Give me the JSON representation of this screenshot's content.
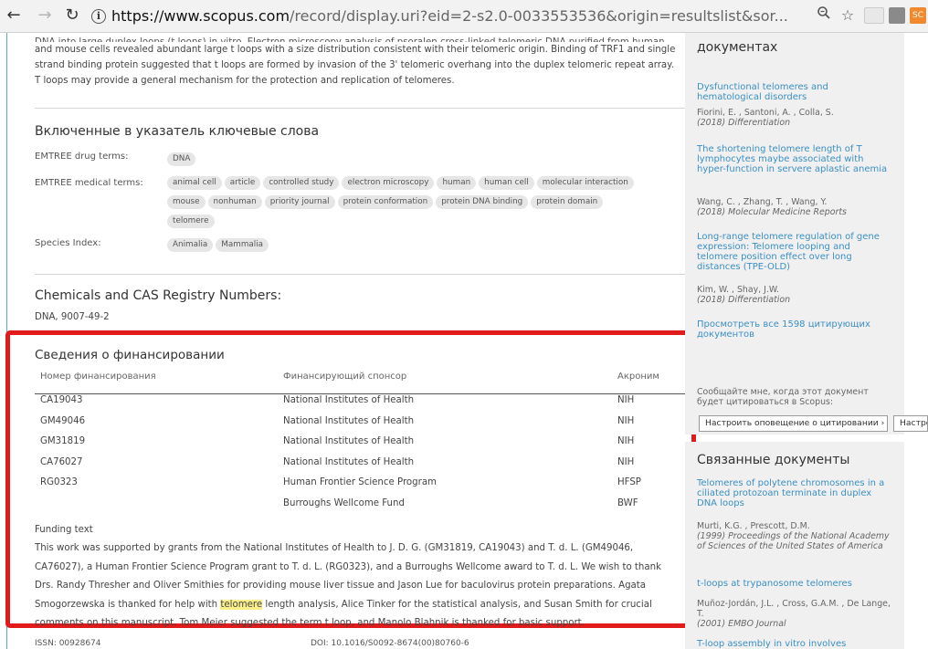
{
  "browser": {
    "url_host": "https://www.scopus.com",
    "url_rest": "/record/display.uri?eid=2-s2.0-0033553536&origin=resultslist&sor...",
    "ext1_label": "",
    "ext2_label": "",
    "ext3_label": "SC"
  },
  "abstract": {
    "cut_line": "DNA into large duplex loops (t loops) in vitro. Electron microscopy analysis of psoralen cross-linked telomeric DNA purified from human",
    "lines": [
      "and mouse cells revealed abundant large t loops with a size distribution consistent with their telomeric origin. Binding of TRF1 and single",
      "strand binding protein suggested that t loops are formed by invasion of the 3' telomeric overhang into the duplex telomeric repeat array.",
      "T loops may provide a general mechanism for the protection and replication of telomeres."
    ]
  },
  "keywords": {
    "title": "Включенные в указатель ключевые слова",
    "drug_label": "EMTREE drug terms:",
    "drug_terms": [
      "DNA"
    ],
    "medical_label": "EMTREE medical terms:",
    "medical_terms": [
      "animal cell",
      "article",
      "controlled study",
      "electron microscopy",
      "human",
      "human cell",
      "molecular interaction",
      "mouse",
      "nonhuman",
      "priority journal",
      "protein conformation",
      "protein DNA binding",
      "protein domain",
      "telomere"
    ],
    "species_label": "Species Index:",
    "species_terms": [
      "Animalia",
      "Mammalia"
    ]
  },
  "chemicals": {
    "title": "Chemicals and CAS Registry Numbers:",
    "value": "DNA, 9007-49-2"
  },
  "funding": {
    "title": "Сведения о финансировании",
    "col_number": "Номер финансирования",
    "col_sponsor": "Финансирующий спонсор",
    "col_acronym": "Акроним",
    "rows": [
      {
        "number": "CA19043",
        "sponsor": "National Institutes of Health",
        "acronym": "NIH"
      },
      {
        "number": "GM49046",
        "sponsor": "National Institutes of Health",
        "acronym": "NIH"
      },
      {
        "number": "GM31819",
        "sponsor": "National Institutes of Health",
        "acronym": "NIH"
      },
      {
        "number": "CA76027",
        "sponsor": "National Institutes of Health",
        "acronym": "NIH"
      },
      {
        "number": "RG0323",
        "sponsor": "Human Frontier Science Program",
        "acronym": "HFSP"
      },
      {
        "number": "",
        "sponsor": "Burroughs Wellcome Fund",
        "acronym": "BWF"
      }
    ],
    "text_label": "Funding text",
    "text_line1": "This work was supported by grants from the National Institutes of Health to J. D. G. (GM31819, CA19043) and T. d. L. (GM49046,",
    "text_line2": "CA76027), a Human Frontier Science Program grant to T. d. L. (RG0323), and a Burroughs Wellcome award to T. d. L. We wish to thank",
    "text_line3": "Drs. Randy Thresher and Oliver Smithies for providing mouse liver tissue and Jason Lue for baculovirus protein preparations. Agata",
    "text_line4_a": "Smogorzewska is thanked for help with ",
    "text_line4_hl": "telomere",
    "text_line4_b": " length analysis, Alice Tinker for the statistical analysis, and Susan Smith for crucial",
    "text_line5": "comments on this manuscript. Tom Meier suggested the term t loop, and Manolo Blahnik is thanked for basic support."
  },
  "bottom": {
    "issn": "ISSN: 00928674",
    "doi": "DOI: 10.1016/S0092-8674(00)80760-6"
  },
  "sidebar": {
    "cited_title": "документах",
    "cited": [
      {
        "title": "Dysfunctional telomeres and hematological disorders",
        "authors": "Fiorini, E. , Santoni, A. , Colla, S.",
        "journal": "(2018) Differentiation"
      },
      {
        "title": "The shortening telomere length of T lymphocytes maybe associated with hyper-function in servere aplastic anemia",
        "authors": "Wang, C. , Zhang, T. , Wang, Y.",
        "journal": "(2018) Molecular Medicine Reports"
      },
      {
        "title": "Long-range telomere regulation of gene expression: Telomere looping and telomere position effect over long distances (TPE-OLD)",
        "authors": "Kim, W. , Shay, J.W.",
        "journal": "(2018) Differentiation"
      }
    ],
    "view_all": "Просмотреть все 1598 цитирующих документов",
    "alert_note": "Сообщайте мне, когда этот документ будет цитироваться в Scopus:",
    "alert_button": "Настроить оповещение о цитировании ›",
    "alert_button2": "Настро",
    "related_title": "Связанные документы",
    "related": [
      {
        "title": "Telomeres of polytene chromosomes in a ciliated protozoan terminate in duplex DNA loops",
        "authors": "Murti, K.G. , Prescott, D.M.",
        "journal": "(1999) Proceedings of the National Academy of Sciences of the United States of America"
      },
      {
        "title": "t-loops at trypanosome telomeres",
        "authors": "Muñoz-Jordán, J.L. , Cross, G.A.M. , De Lange, T.",
        "journal": "(2001) EMBO Journal"
      },
      {
        "title": "T-loop assembly in vitro involves",
        "authors": "",
        "journal": ""
      }
    ]
  },
  "colors": {
    "accent_link": "#3b8fc4",
    "highlight_box": "#e11b1b",
    "keyword_highlight": "#fbef8a"
  }
}
